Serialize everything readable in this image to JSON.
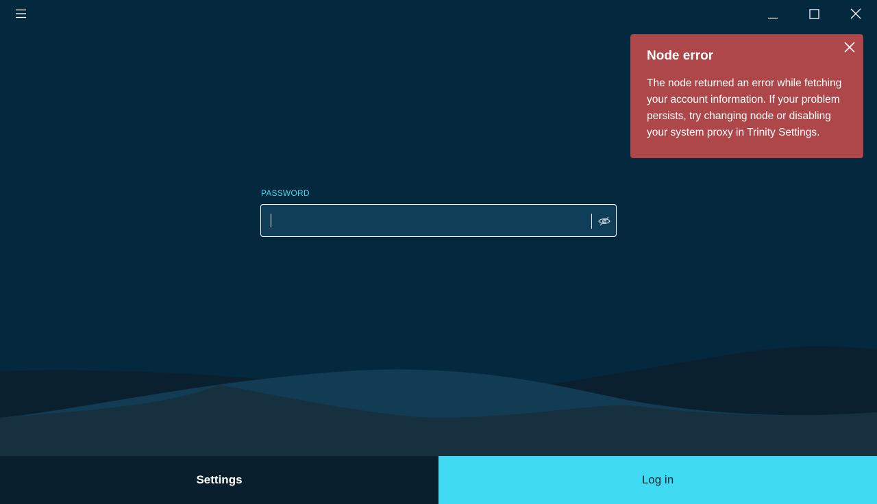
{
  "titlebar": {
    "menu_icon": "hamburger-menu-icon",
    "minimize_icon": "minimize-icon",
    "maximize_icon": "maximize-icon",
    "close_icon": "close-icon"
  },
  "toast": {
    "title": "Node error",
    "message": "The node returned an error while fetching your account information. If your problem persists, try changing node or disabling your system proxy in Trinity Settings.",
    "close_icon": "close-icon",
    "color": "#ad4749"
  },
  "password": {
    "label": "PASSWORD",
    "value": "",
    "placeholder": "",
    "toggle_icon": "eye-off-icon"
  },
  "footer": {
    "settings_label": "Settings",
    "login_label": "Log in"
  },
  "colors": {
    "background": "#04283e",
    "accent": "#3fdaf2",
    "error": "#ad4749",
    "footer_dark": "#091f2d"
  }
}
